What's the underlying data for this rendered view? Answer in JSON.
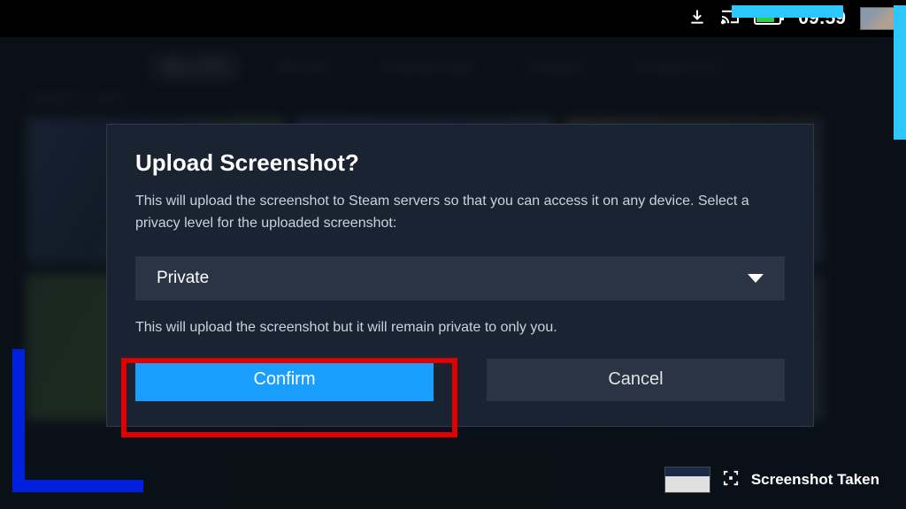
{
  "status": {
    "time": "09:59"
  },
  "bgTabs": [
    "ALL (77)",
    "Recent",
    "Friends Only",
    "Unlisted",
    "Private (77)"
  ],
  "bgLabel": "AUGUST 7, 2023",
  "dialog": {
    "title": "Upload Screenshot?",
    "desc": "This will upload the screenshot to Steam servers so that you can access it on any device. Select a privacy level for the uploaded screenshot:",
    "dropdownValue": "Private",
    "note": "This will upload the screenshot but it will remain private to only you.",
    "confirmLabel": "Confirm",
    "cancelLabel": "Cancel"
  },
  "toast": {
    "text": "Screenshot Taken"
  }
}
